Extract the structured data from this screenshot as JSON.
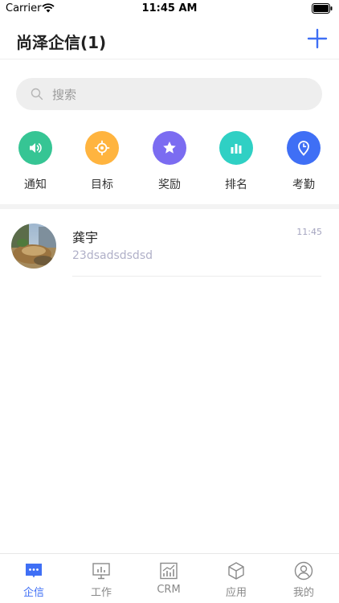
{
  "status_bar": {
    "carrier": "Carrier",
    "time": "11:45 AM"
  },
  "header": {
    "title": "尚泽企信(1)",
    "add_icon": "plus-icon"
  },
  "search": {
    "placeholder": "搜索"
  },
  "shortcuts": [
    {
      "label": "通知",
      "icon": "speaker-icon",
      "color": "#36c594"
    },
    {
      "label": "目标",
      "icon": "target-icon",
      "color": "#ffb43f"
    },
    {
      "label": "奖励",
      "icon": "star-icon",
      "color": "#7b6cf1"
    },
    {
      "label": "排名",
      "icon": "bar-chart-icon",
      "color": "#2fd0c4"
    },
    {
      "label": "考勤",
      "icon": "location-clock-icon",
      "color": "#3f6ff5"
    }
  ],
  "chats": [
    {
      "name": "龚宇",
      "preview": "23dsadsdsdsd",
      "time": "11:45"
    }
  ],
  "tabs": [
    {
      "label": "企信",
      "icon": "chat-bubble-icon",
      "active": true
    },
    {
      "label": "工作",
      "icon": "presentation-icon",
      "active": false
    },
    {
      "label": "CRM",
      "icon": "trend-chart-icon",
      "active": false
    },
    {
      "label": "应用",
      "icon": "cube-icon",
      "active": false
    },
    {
      "label": "我的",
      "icon": "user-icon",
      "active": false
    }
  ],
  "colors": {
    "accent": "#3f6ff5",
    "inactive": "#888888"
  }
}
